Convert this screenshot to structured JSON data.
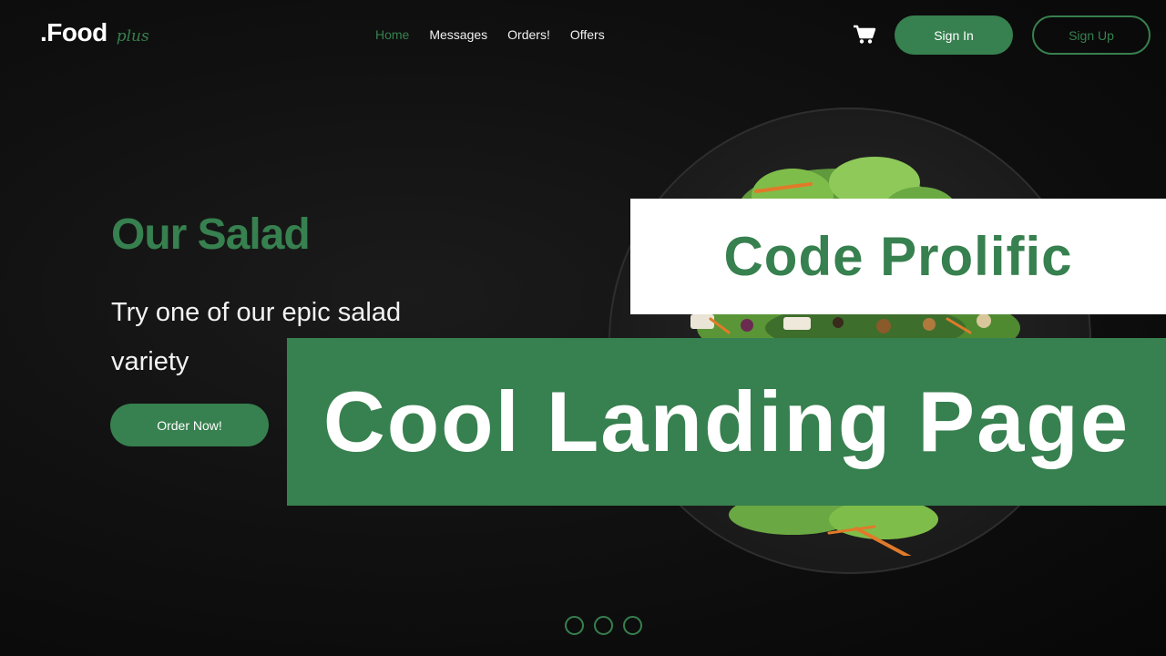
{
  "brand": {
    "name": ".Food",
    "tagline": "plus"
  },
  "nav": {
    "links": [
      {
        "label": "Home",
        "active": true
      },
      {
        "label": "Messages",
        "active": false
      },
      {
        "label": "Orders!",
        "active": false
      },
      {
        "label": "Offers",
        "active": false
      }
    ],
    "cart_icon": "shopping-cart-icon",
    "signin_label": "Sign In",
    "signup_label": "Sign Up"
  },
  "hero": {
    "title": "Our Salad",
    "text": "Try one of our epic salad variety",
    "cta_label": "Order Now!"
  },
  "overlay": {
    "channel": "Code Prolific",
    "headline": "Cool Landing Page"
  },
  "carousel": {
    "slides": 3
  },
  "colors": {
    "accent": "#37804f",
    "background": "#0c0c0c",
    "text": "#ffffff"
  }
}
